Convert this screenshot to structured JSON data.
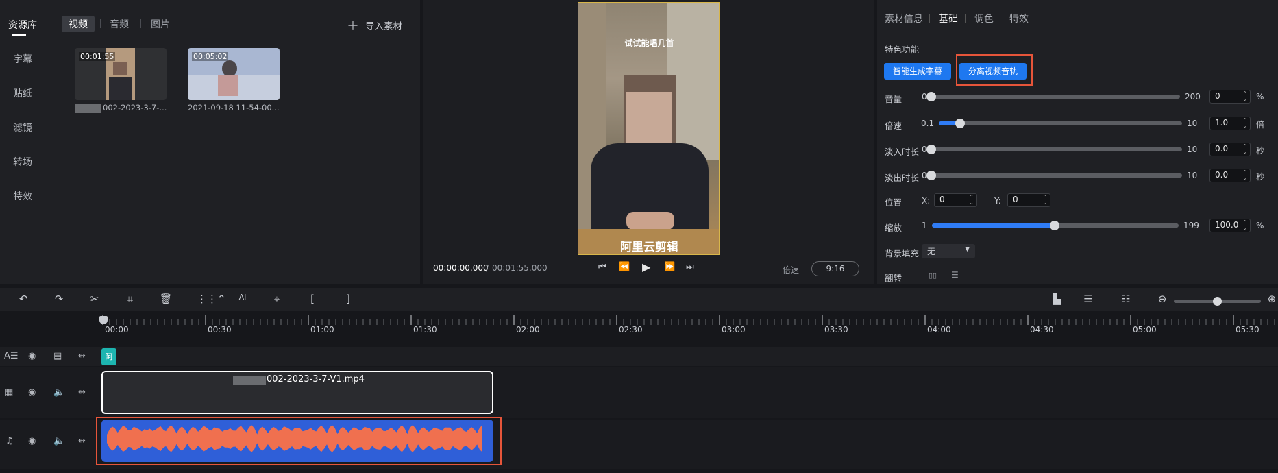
{
  "left_nav": {
    "items": [
      {
        "label": "资源库",
        "active": true
      },
      {
        "label": "字幕"
      },
      {
        "label": "贴纸"
      },
      {
        "label": "滤镜"
      },
      {
        "label": "转场"
      },
      {
        "label": "特效"
      }
    ]
  },
  "library": {
    "tabs": [
      "视频",
      "音频",
      "图片"
    ],
    "import_label": "导入素材",
    "items": [
      {
        "duration": "00:01:55",
        "name": "002-2023-3-7-..."
      },
      {
        "duration": "00:05:02",
        "name": "2021-09-18 11-54-00..."
      }
    ]
  },
  "preview": {
    "caption_top": "试试能唱几首",
    "caption_bottom": "阿里云剪辑",
    "time_current": "00:00:00.000",
    "time_separator": "/",
    "time_total": "00:01:55.000",
    "speed_label": "倍速",
    "aspect": "9:16"
  },
  "props": {
    "tabs": [
      "素材信息",
      "基础",
      "调色",
      "特效"
    ],
    "active_tab": "基础",
    "section_title": "特色功能",
    "btn_subtitle": "智能生成字幕",
    "btn_separate": "分离视频音轨",
    "volume": {
      "label": "音量",
      "min": "0",
      "max": "200",
      "value": "0",
      "unit": "%"
    },
    "speed": {
      "label": "倍速",
      "min": "0.1",
      "max": "10",
      "value": "1.0",
      "unit": "倍"
    },
    "fadein": {
      "label": "淡入时长",
      "min": "0",
      "max": "10",
      "value": "0.0",
      "unit": "秒"
    },
    "fadeout": {
      "label": "淡出时长",
      "min": "0",
      "max": "10",
      "value": "0.0",
      "unit": "秒"
    },
    "position": {
      "label": "位置",
      "x_label": "X:",
      "x": "0",
      "y_label": "Y:",
      "y": "0"
    },
    "scale": {
      "label": "缩放",
      "min": "1",
      "max": "199",
      "value": "100.0",
      "unit": "%"
    },
    "bgfill": {
      "label": "背景填充",
      "value": "无"
    },
    "flip": {
      "label": "翻转"
    }
  },
  "timeline": {
    "ticks": [
      "00:00",
      "00:30",
      "01:00",
      "01:30",
      "02:00",
      "02:30",
      "03:00",
      "03:30",
      "04:00",
      "04:30",
      "05:00",
      "05:30"
    ],
    "subtitle_chip": "阿",
    "video_clip_name": "002-2023-3-7-V1.mp4",
    "colors": {
      "audio_bg": "#2f5fd8",
      "wave": "#f0704f",
      "highlight": "#e6553a"
    }
  }
}
